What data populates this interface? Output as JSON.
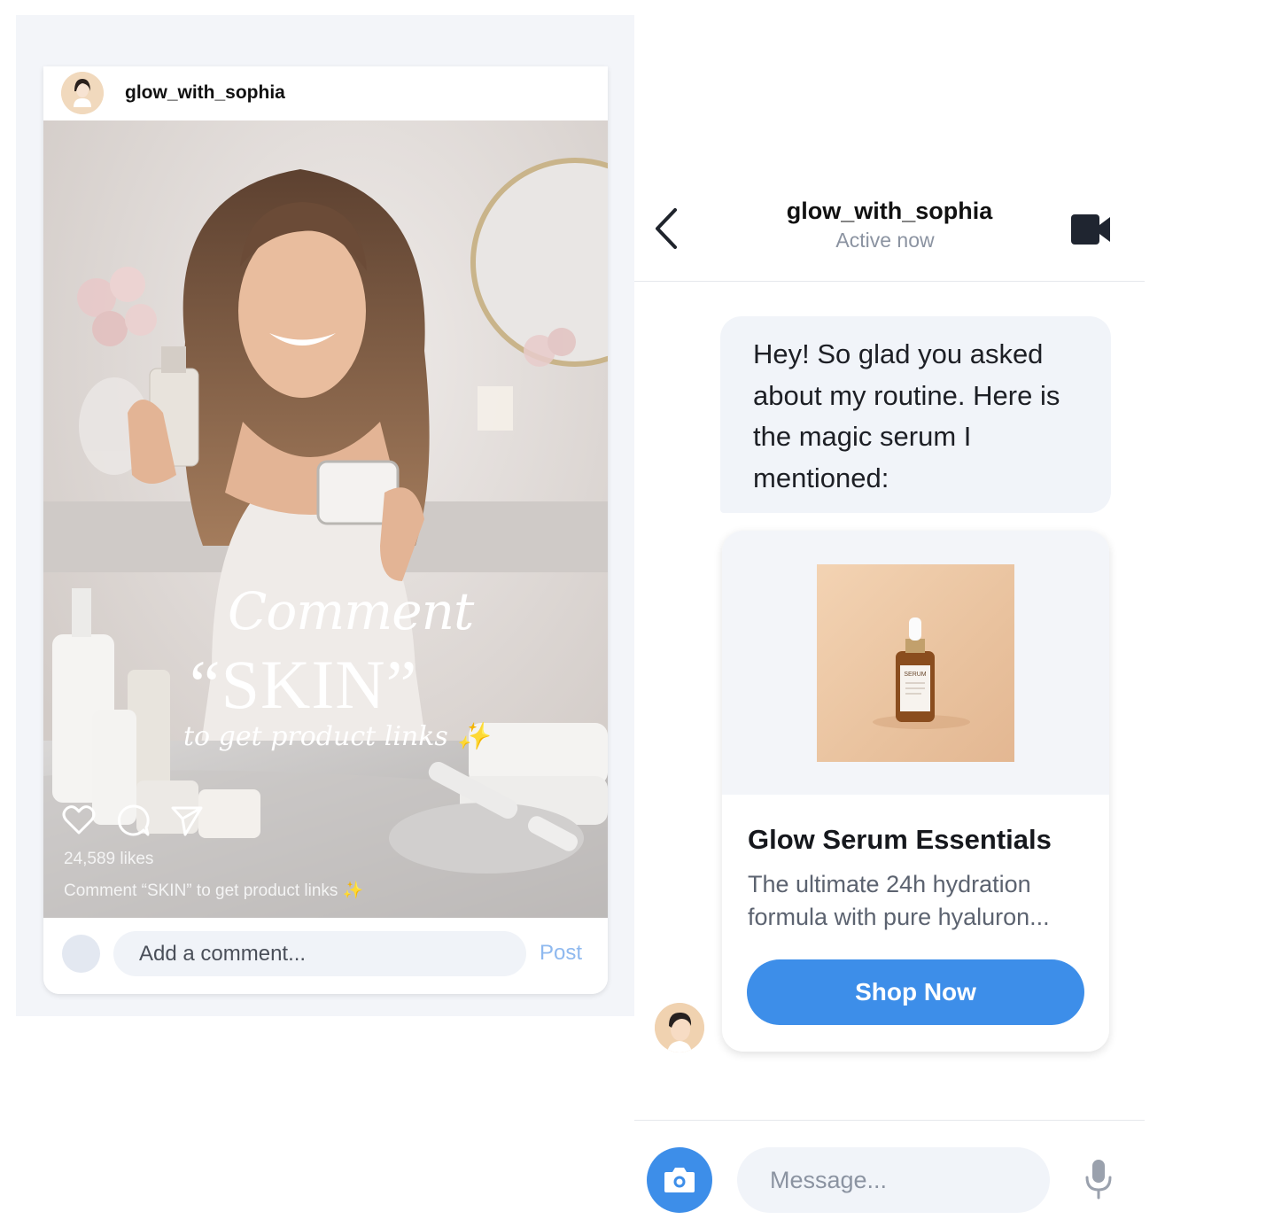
{
  "post": {
    "username": "glow_with_sophia",
    "overlay": {
      "headline_script": "Comment",
      "headline_keyword": "“SKIN”",
      "headline_sub": "to get product links ✨"
    },
    "icons": [
      "heart-icon",
      "comment-icon",
      "send-icon"
    ],
    "likes": "24,589 likes",
    "caption": "Comment “SKIN” to get product links ✨",
    "comment_placeholder": "Add a comment...",
    "post_button": "Post"
  },
  "chat": {
    "contact_name": "glow_with_sophia",
    "status": "Active now",
    "message": "Hey! So glad you asked about my routine. Here is the magic serum I mentioned:",
    "product": {
      "bottle_label": "SERUM",
      "title": "Glow Serum Essentials",
      "description": "The ultimate 24h hydration formula with pure hyaluron...",
      "cta": "Shop Now"
    },
    "composer_placeholder": "Message...",
    "icons": [
      "back-icon",
      "video-call-icon",
      "camera-icon",
      "microphone-icon"
    ],
    "colors": {
      "accent": "#3d8ee9",
      "bubble": "#f1f4f9",
      "muted": "#8b93a1"
    }
  }
}
